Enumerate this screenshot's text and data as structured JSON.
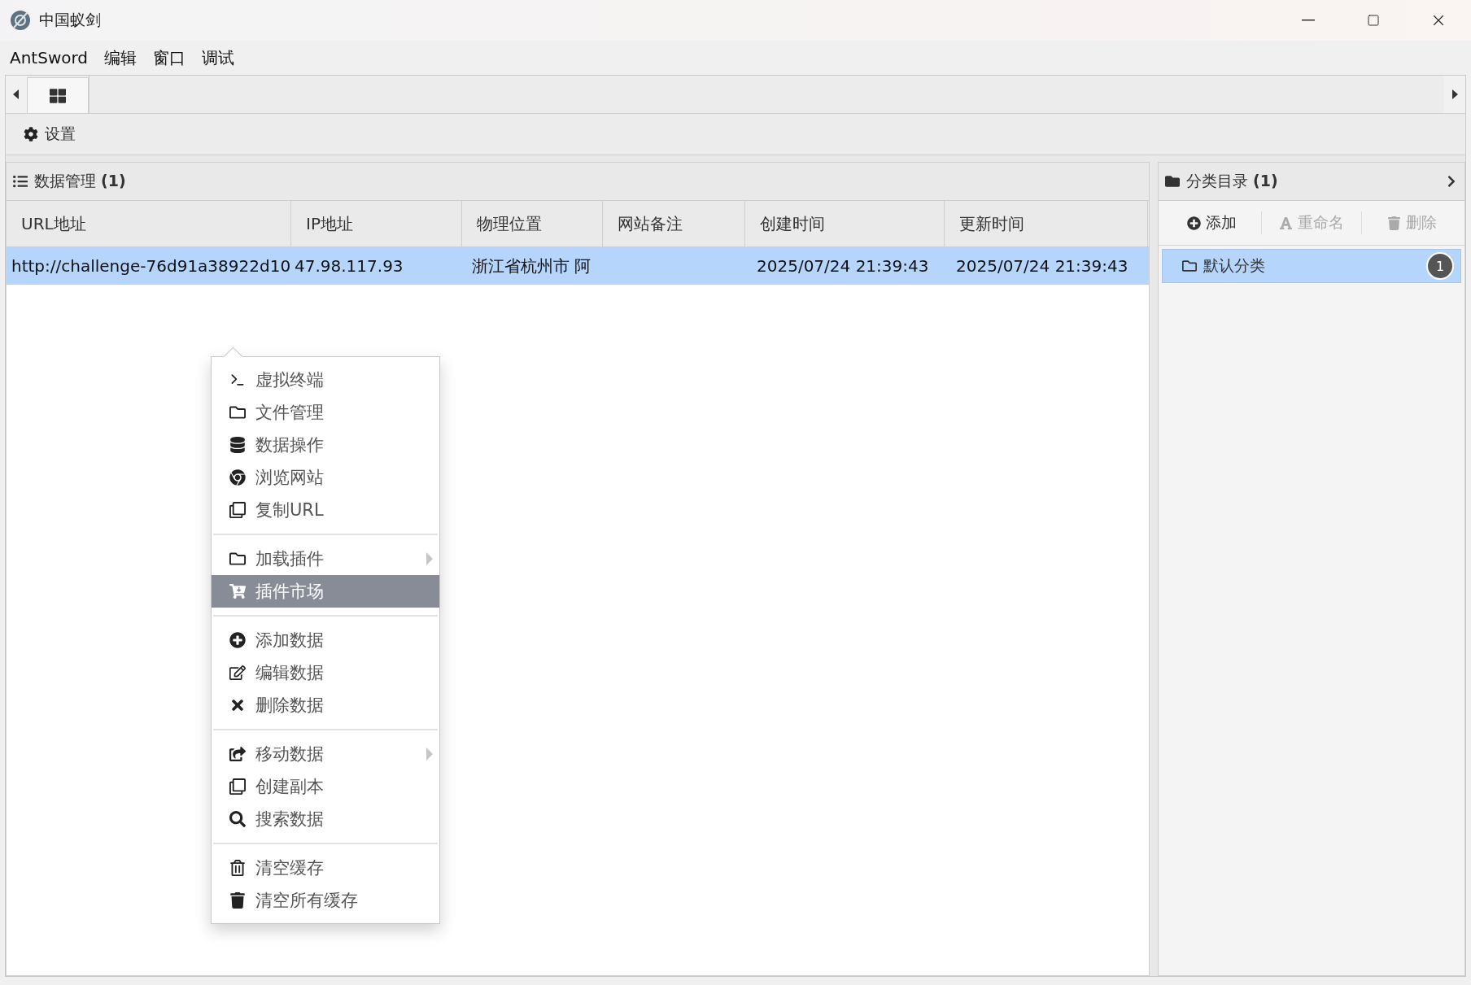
{
  "window": {
    "title": "中国蚁剑"
  },
  "menu_bar": [
    "AntSword",
    "编辑",
    "窗口",
    "调试"
  ],
  "tabs": [
    {
      "selected": true
    }
  ],
  "toolbar": {
    "label": "设置"
  },
  "data_panel": {
    "title": "数据管理",
    "count": "(1)",
    "columns": [
      "URL地址",
      "IP地址",
      "物理位置",
      "网站备注",
      "创建时间",
      "更新时间"
    ],
    "rows": [
      {
        "selected": true,
        "cells": [
          "http://challenge-76d91a38922d10",
          "47.98.117.93",
          "浙江省杭州市 阿",
          "",
          "2025/07/24 21:39:43",
          "2025/07/24 21:39:43"
        ]
      }
    ]
  },
  "category_panel": {
    "title": "分类目录",
    "count": "(1)",
    "buttons": [
      {
        "label": "添加",
        "disabled": false
      },
      {
        "label": "重命名",
        "disabled": true
      },
      {
        "label": "删除",
        "disabled": true
      }
    ],
    "items": [
      {
        "label": "默认分类",
        "badge": "1",
        "selected": true
      }
    ]
  },
  "context_menu": [
    [
      {
        "label": "虚拟终端",
        "submenu": false,
        "selected": false
      },
      {
        "label": "文件管理",
        "submenu": false,
        "selected": false
      },
      {
        "label": "数据操作",
        "submenu": false,
        "selected": false
      },
      {
        "label": "浏览网站",
        "submenu": false,
        "selected": false
      },
      {
        "label": "复制URL",
        "submenu": false,
        "selected": false
      }
    ],
    [
      {
        "label": "加载插件",
        "submenu": true,
        "selected": false
      },
      {
        "label": "插件市场",
        "submenu": false,
        "selected": true
      }
    ],
    [
      {
        "label": "添加数据",
        "submenu": false,
        "selected": false
      },
      {
        "label": "编辑数据",
        "submenu": false,
        "selected": false
      },
      {
        "label": "删除数据",
        "submenu": false,
        "selected": false
      }
    ],
    [
      {
        "label": "移动数据",
        "submenu": true,
        "selected": false
      },
      {
        "label": "创建副本",
        "submenu": false,
        "selected": false
      },
      {
        "label": "搜索数据",
        "submenu": false,
        "selected": false
      }
    ],
    [
      {
        "label": "清空缓存",
        "submenu": false,
        "selected": false
      },
      {
        "label": "清空所有缓存",
        "submenu": false,
        "selected": false
      }
    ]
  ]
}
